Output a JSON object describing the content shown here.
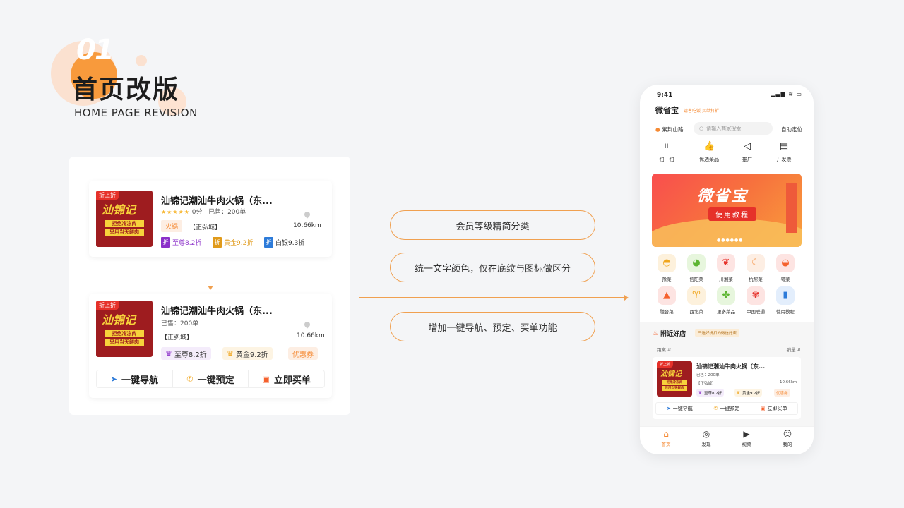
{
  "header": {
    "number": "01",
    "title": "首页改版",
    "subtitle": "HOME PAGE REVISION"
  },
  "card_before": {
    "thumb_tag": "折上折",
    "thumb_brand": "汕锦记",
    "thumb_line1": "拒绝冷冻肉",
    "thumb_line2": "只用当天鲜肉",
    "name": "汕锦记潮汕牛肉火锅（东...",
    "rating": "0分",
    "sold": "已售：200单",
    "category": "火锅",
    "area": "【正弘城】",
    "distance": "10.66km",
    "discounts": [
      {
        "icon": "折",
        "label": "至尊8.2折",
        "color": "#8b2fc9"
      },
      {
        "icon": "折",
        "label": "黄金9.2折",
        "color": "#e09a1a"
      },
      {
        "icon": "折",
        "label": "白银9.3折",
        "color": "#2d7bd9"
      }
    ]
  },
  "card_after": {
    "thumb_tag": "折上折",
    "thumb_brand": "汕锦记",
    "thumb_line1": "拒绝冷冻肉",
    "thumb_line2": "只用当天鲜肉",
    "name": "汕锦记潮汕牛肉火锅（东...",
    "sold": "已售：200单",
    "area": "【正弘城】",
    "distance": "10.66km",
    "badges": {
      "vip": "至尊8.2折",
      "gold": "黄金9.2折",
      "coupon": "优惠券"
    },
    "actions": {
      "nav": "一键导航",
      "book": "一键预定",
      "buy": "立即买单"
    }
  },
  "features": [
    "会员等级精简分类",
    "统一文字颜色，仅在底纹与图标做区分",
    "增加一键导航、预定、买单功能"
  ],
  "phone": {
    "time": "9:41",
    "status": "▂▄▆ ≋ ▭",
    "app_name": "微省宝",
    "slogan": "请客吃饭 买单打折",
    "location": "紫荆山路",
    "search_placeholder": "请输入商家搜索",
    "auto_locate": "自助定位",
    "quick": [
      "扫一扫",
      "优选菜品",
      "推广",
      "开发票"
    ],
    "banner_title": "微省宝",
    "banner_button": "使用教程",
    "banner_dots": "●●●●●●",
    "categories": [
      "豫菜",
      "信阳菜",
      "川湘菜",
      "杭帮菜",
      "粤菜",
      "融合菜",
      "西北菜",
      "更多菜品",
      "中国联通",
      "使用教程"
    ],
    "nearby_title": "附近好店",
    "nearby_tag": "严选好折扣的微信好店",
    "sort_distance": "距离 ⇵",
    "sort_sales": "销量 ⇵",
    "mini_card": {
      "tag": "折上折",
      "brand": "汕锦记",
      "line1": "拒绝冷冻肉",
      "line2": "只用当天鲜肉",
      "name": "汕锦记潮汕牛肉火锅（东...",
      "sold": "已售：200单",
      "area": "【正弘城】",
      "distance": "10.66km",
      "vip": "至尊8.2折",
      "gold": "黄金9.2折",
      "coupon": "优惠券",
      "nav": "一键导航",
      "book": "一键预定",
      "buy": "立即买单"
    },
    "tabs": [
      "首页",
      "发现",
      "视频",
      "我的"
    ]
  },
  "colors": {
    "accent": "#f58a34",
    "brand_red": "#e6312a"
  }
}
